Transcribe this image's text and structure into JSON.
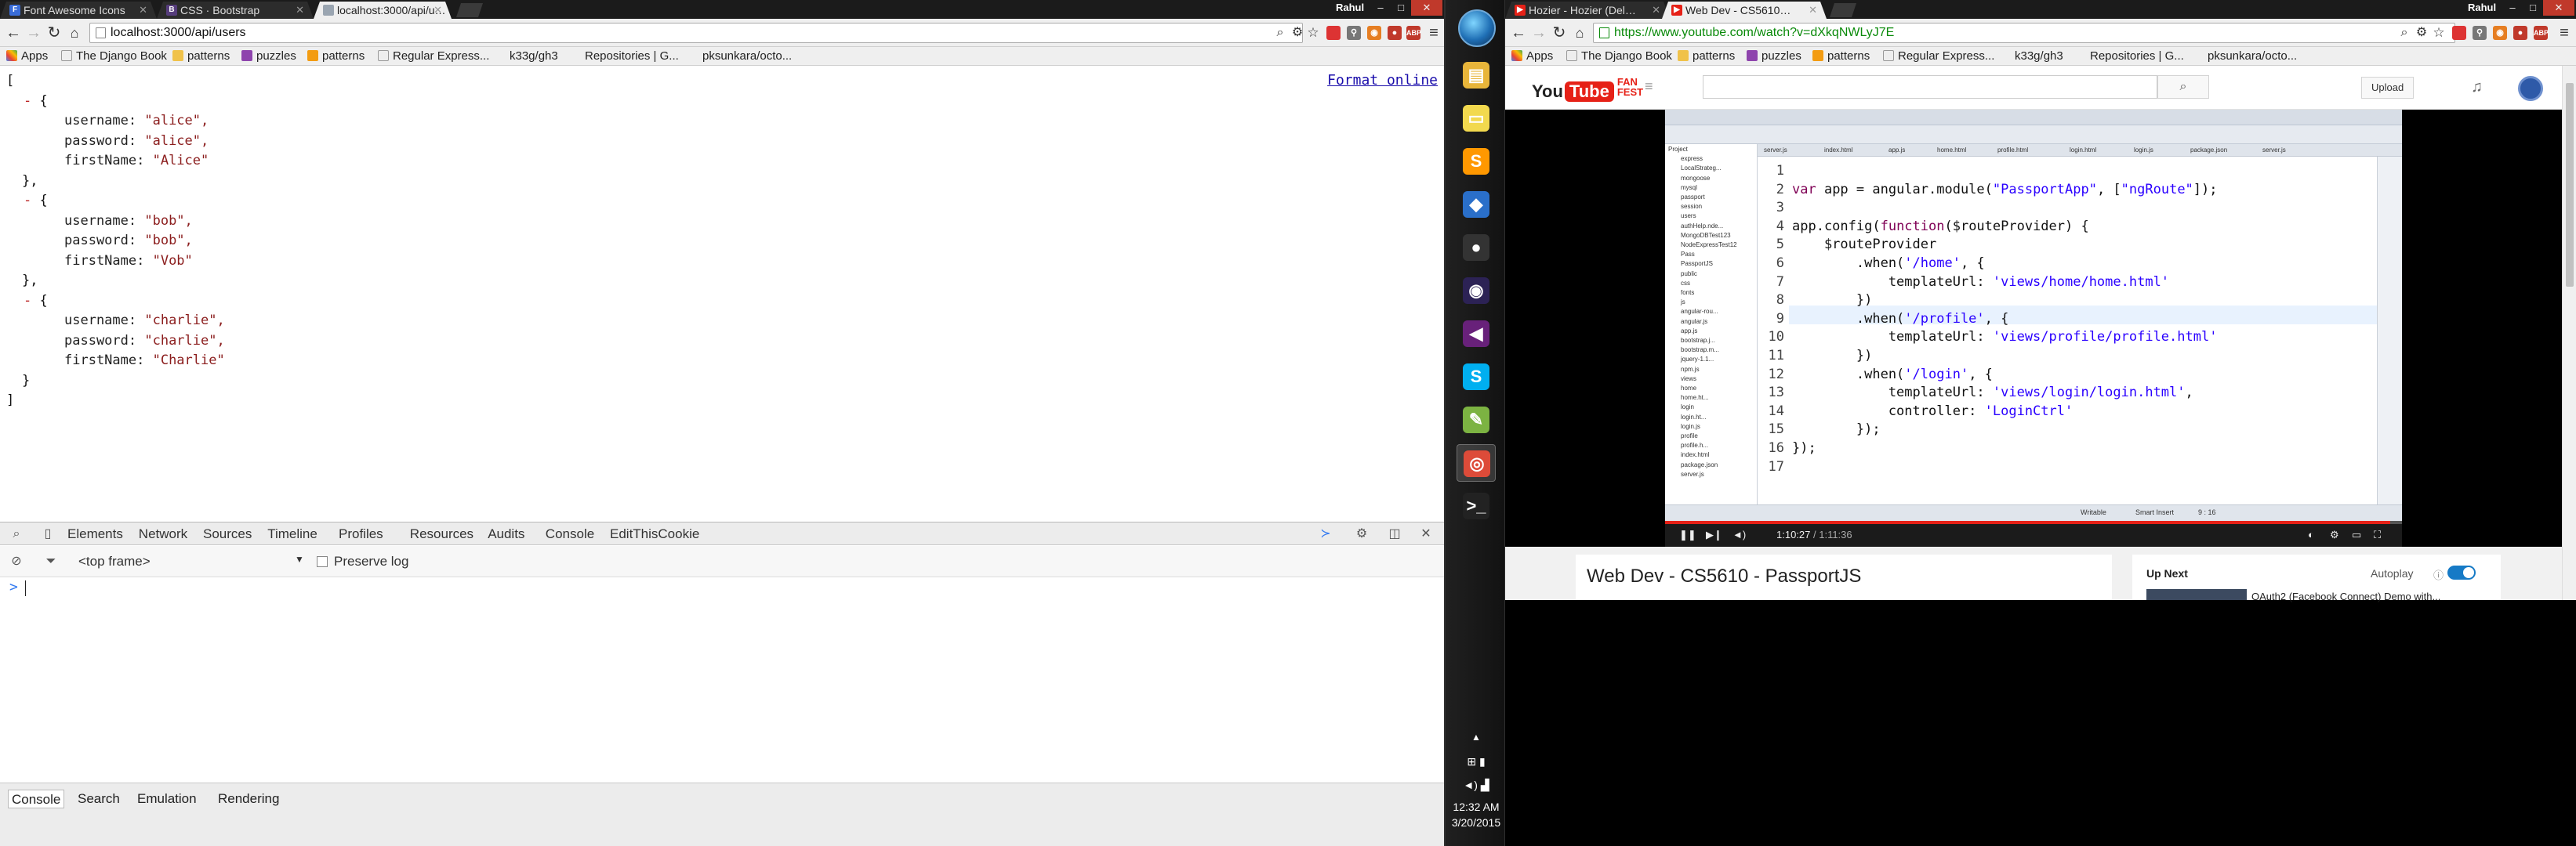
{
  "left_browser": {
    "tabs": [
      {
        "title": "Font Awesome Icons",
        "icon_color": "#3a6dd8",
        "icon_glyph": "F"
      },
      {
        "title": "CSS · Bootstrap",
        "icon_color": "#563d7c",
        "icon_glyph": "B"
      },
      {
        "title": "localhost:3000/api/u…",
        "icon_color": "#9aa5b1",
        "icon_glyph": ""
      }
    ],
    "user": "Rahul",
    "url": "localhost:3000/api/users",
    "bookmarks": [
      "Apps",
      "The Django Book",
      "patterns",
      "puzzles",
      "patterns",
      "Regular Express...",
      "k33g/gh3",
      "Repositories | G...",
      "pksunkara/octo..."
    ],
    "format_online": "Format online",
    "json_lines": [
      {
        "text": "[",
        "indent": 0,
        "kind": "bracket"
      },
      {
        "marker": "-",
        "text": "{",
        "indent": 1,
        "kind": "bracket"
      },
      {
        "key": "username:",
        "value": "\"alice\",",
        "indent": 2
      },
      {
        "key": "password:",
        "value": "\"alice\",",
        "indent": 2
      },
      {
        "key": "firstName:",
        "value": "\"Alice\"",
        "indent": 2
      },
      {
        "text": "},",
        "indent": 1,
        "kind": "bracket"
      },
      {
        "marker": "-",
        "text": "{",
        "indent": 1,
        "kind": "bracket"
      },
      {
        "key": "username:",
        "value": "\"bob\",",
        "indent": 2
      },
      {
        "key": "password:",
        "value": "\"bob\",",
        "indent": 2
      },
      {
        "key": "firstName:",
        "value": "\"Vob\"",
        "indent": 2
      },
      {
        "text": "},",
        "indent": 1,
        "kind": "bracket"
      },
      {
        "marker": "-",
        "text": "{",
        "indent": 1,
        "kind": "bracket"
      },
      {
        "key": "username:",
        "value": "\"charlie\",",
        "indent": 2
      },
      {
        "key": "password:",
        "value": "\"charlie\",",
        "indent": 2
      },
      {
        "key": "firstName:",
        "value": "\"Charlie\"",
        "indent": 2
      },
      {
        "text": "}",
        "indent": 1,
        "kind": "bracket"
      },
      {
        "text": "]",
        "indent": 0,
        "kind": "bracket"
      }
    ],
    "devtools": {
      "tabs": [
        "Elements",
        "Network",
        "Sources",
        "Timeline",
        "Profiles",
        "Resources",
        "Audits",
        "Console",
        "EditThisCookie"
      ],
      "frame_select": "<top frame>",
      "preserve_log": "Preserve log",
      "prompt": ">",
      "drawer_tabs": [
        "Console",
        "Search",
        "Emulation",
        "Rendering"
      ]
    }
  },
  "taskbar": {
    "apps": [
      {
        "name": "file-explorer",
        "color": "#e8b53a",
        "glyph": "▤"
      },
      {
        "name": "sticky-notes",
        "color": "#f2d94e",
        "glyph": "▭"
      },
      {
        "name": "sublime-text",
        "color": "#ff9800",
        "glyph": "S"
      },
      {
        "name": "virtualbox",
        "color": "#2a6fc9",
        "glyph": "◆"
      },
      {
        "name": "github",
        "color": "#333333",
        "glyph": "●"
      },
      {
        "name": "eclipse",
        "color": "#2c2255",
        "glyph": "◉"
      },
      {
        "name": "visual-studio",
        "color": "#68217a",
        "glyph": "◀"
      },
      {
        "name": "skype",
        "color": "#00aff0",
        "glyph": "S"
      },
      {
        "name": "notepad-plus",
        "color": "#7cb342",
        "glyph": "✎"
      },
      {
        "name": "chrome",
        "color": "#dd4b39",
        "glyph": "◎"
      },
      {
        "name": "terminal",
        "color": "#222222",
        "glyph": ">_"
      }
    ],
    "time": "12:32 AM",
    "date": "3/20/2015"
  },
  "right_browser": {
    "tabs": [
      {
        "title": "Hozier - Hozier (Del…",
        "icon_color": "#e62117",
        "icon_glyph": "▶"
      },
      {
        "title": "Web Dev - CS5610…",
        "icon_color": "#e62117",
        "icon_glyph": "▶"
      }
    ],
    "user": "Rahul",
    "url": "https://www.youtube.com/watch?v=dXkqNWLyJ7E",
    "bookmarks": [
      "Apps",
      "The Django Book",
      "patterns",
      "puzzles",
      "patterns",
      "Regular Express...",
      "k33g/gh3",
      "Repositories | G...",
      "pksunkara/octo..."
    ],
    "youtube": {
      "logo_you": "You",
      "logo_tube": "Tube",
      "logo_fan": "FAN",
      "logo_fest": "FEST",
      "upload": "Upload",
      "current_time": "1:10:27",
      "duration": "/ 1:11:36",
      "progress": 0.984,
      "video_title": "Web Dev - CS5610 - PassportJS",
      "up_next": "Up Next",
      "autoplay": "Autoplay",
      "next_video": "OAuth2 (Facebook Connect) Demo with..."
    },
    "ide": {
      "tabs": [
        "server.js",
        "index.html",
        "app.js",
        "home.html",
        "profile.html",
        "login.html",
        "login.js",
        "package.json",
        "server.js"
      ],
      "tree": [
        "Project",
        "express",
        "LocalStrateg...",
        "mongoose",
        "mysql",
        "passport",
        "session",
        "users",
        "authHelp.nde...",
        "MongoDBTest123",
        "NodeExpressTest12",
        "Pass",
        "PassportJS",
        "public",
        "css",
        "fonts",
        "js",
        "angular-rou...",
        "angular.js",
        "app.js",
        "bootstrap.j...",
        "bootstrap.m...",
        "jquery-1.1...",
        "npm.js",
        "views",
        "home",
        "home.ht...",
        "login",
        "login.ht...",
        "login.js",
        "profile",
        "profile.h...",
        "index.html",
        "package.json",
        "server.js"
      ],
      "code": [
        [],
        [
          {
            "t": "var ",
            "c": "kw"
          },
          {
            "t": "app = angular.module(",
            "c": "fn"
          },
          {
            "t": "\"PassportApp\"",
            "c": "str"
          },
          {
            "t": ", [",
            "c": "fn"
          },
          {
            "t": "\"ngRoute\"",
            "c": "str"
          },
          {
            "t": "]);",
            "c": "fn"
          }
        ],
        [],
        [
          {
            "t": "app.config(",
            "c": "fn"
          },
          {
            "t": "function",
            "c": "kw"
          },
          {
            "t": "($routeProvider) {",
            "c": "fn"
          }
        ],
        [
          {
            "t": "    $routeProvider",
            "c": "fn"
          }
        ],
        [
          {
            "t": "        .when(",
            "c": "fn"
          },
          {
            "t": "'/home'",
            "c": "str"
          },
          {
            "t": ", {",
            "c": "fn"
          }
        ],
        [
          {
            "t": "            templateUrl: ",
            "c": "fn"
          },
          {
            "t": "'views/home/home.html'",
            "c": "str"
          }
        ],
        [
          {
            "t": "        })",
            "c": "fn"
          }
        ],
        [
          {
            "t": "        .when(",
            "c": "fn"
          },
          {
            "t": "'/profile'",
            "c": "str"
          },
          {
            "t": ", {",
            "c": "fn"
          }
        ],
        [
          {
            "t": "            templateUrl: ",
            "c": "fn"
          },
          {
            "t": "'views/profile/profile.html'",
            "c": "str"
          }
        ],
        [
          {
            "t": "        })",
            "c": "fn"
          }
        ],
        [
          {
            "t": "        .when(",
            "c": "fn"
          },
          {
            "t": "'/login'",
            "c": "str"
          },
          {
            "t": ", {",
            "c": "fn"
          }
        ],
        [
          {
            "t": "            templateUrl: ",
            "c": "fn"
          },
          {
            "t": "'views/login/login.html'",
            "c": "str"
          },
          {
            "t": ",",
            "c": "fn"
          }
        ],
        [
          {
            "t": "            controller: ",
            "c": "fn"
          },
          {
            "t": "'LoginCtrl'",
            "c": "str"
          }
        ],
        [
          {
            "t": "        });",
            "c": "fn"
          }
        ],
        [
          {
            "t": "});",
            "c": "fn"
          }
        ],
        []
      ],
      "status": [
        "Writable",
        "Smart Insert",
        "9 : 16"
      ]
    }
  }
}
